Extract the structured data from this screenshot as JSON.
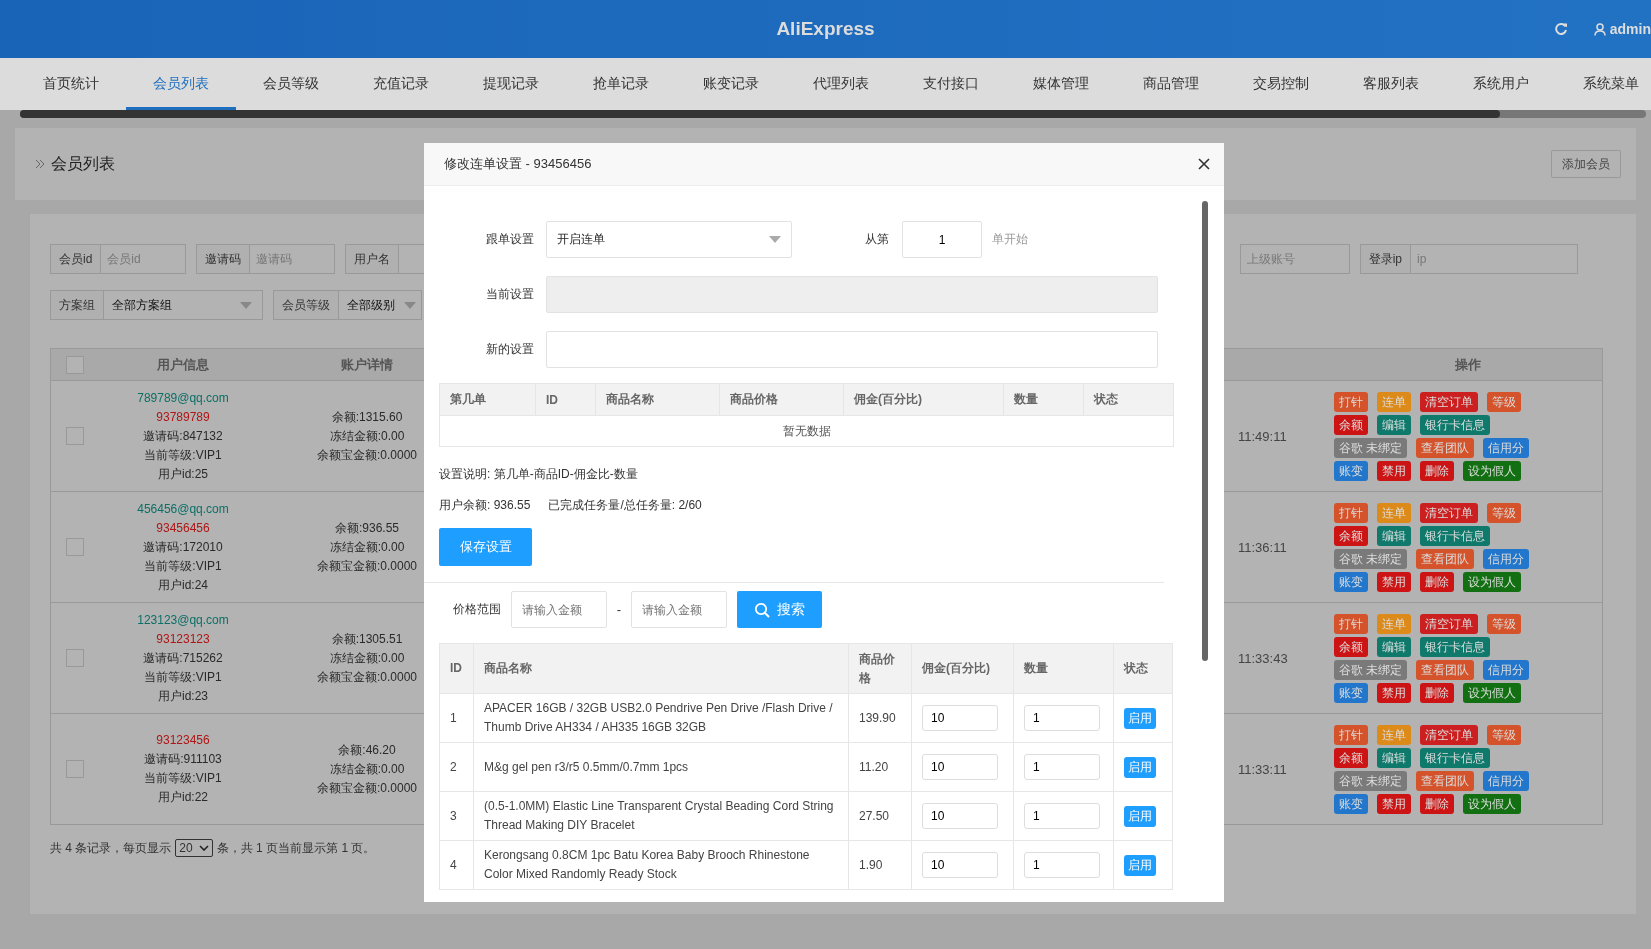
{
  "header": {
    "title": "AliExpress",
    "user": "admin"
  },
  "nav": [
    {
      "label": "首页统计",
      "selected": false
    },
    {
      "label": "会员列表",
      "selected": true
    },
    {
      "label": "会员等级",
      "selected": false
    },
    {
      "label": "充值记录",
      "selected": false
    },
    {
      "label": "提现记录",
      "selected": false
    },
    {
      "label": "抢单记录",
      "selected": false
    },
    {
      "label": "账变记录",
      "selected": false
    },
    {
      "label": "代理列表",
      "selected": false
    },
    {
      "label": "支付接口",
      "selected": false
    },
    {
      "label": "媒体管理",
      "selected": false
    },
    {
      "label": "商品管理",
      "selected": false
    },
    {
      "label": "交易控制",
      "selected": false
    },
    {
      "label": "客服列表",
      "selected": false
    },
    {
      "label": "系统用户",
      "selected": false
    },
    {
      "label": "系统菜单",
      "selected": false
    }
  ],
  "page": {
    "breadcrumb": "会员列表",
    "add_button": "添加会员"
  },
  "filters": {
    "row_1": [
      {
        "kind": "input",
        "label": "会员id",
        "placeholder": "会员id"
      },
      {
        "kind": "input",
        "label": "邀请码",
        "placeholder": "邀请码"
      },
      {
        "kind": "input",
        "label": "用户名"
      }
    ],
    "row_1_right": [
      {
        "kind": "input",
        "placeholder": "上级账号"
      },
      {
        "kind": "input",
        "label": "登录ip",
        "placeholder": "ip"
      }
    ],
    "row_2": [
      {
        "kind": "select",
        "label": "方案组",
        "value": "全部方案组"
      },
      {
        "kind": "select",
        "label": "会员等级",
        "value": "全部级别"
      }
    ]
  },
  "members": {
    "select_all_checked": false,
    "columns": [
      "用户信息",
      "账户详情",
      "操作"
    ],
    "rows": [
      {
        "checked": false,
        "email": "789789@qq.com",
        "phone": "93789789",
        "invite": "邀请码:847132",
        "level": "当前等级:VIP1",
        "user_id": "用户id:25",
        "balance": "余额:1315.60",
        "frozen": "冻结金额:0.00",
        "yeb": "余额宝金额:0.0000",
        "time": "11:49:11",
        "actions": [
          [
            {
              "label": "打针",
              "color": "#d4532b"
            },
            {
              "label": "连单",
              "color": "#dc8a1a"
            },
            {
              "label": "清空订单",
              "color": "#cc2020"
            },
            {
              "label": "等级",
              "color": "#d4532b"
            }
          ],
          [
            {
              "label": "余额",
              "color": "#cc1414"
            },
            {
              "label": "编辑",
              "color": "#0f7a6c"
            },
            {
              "label": "银行卡信息",
              "color": "#0f7a6c"
            }
          ],
          [
            {
              "label": "谷歌 未绑定",
              "color": "#7a7a7a"
            },
            {
              "label": "查看团队",
              "color": "#d4532b"
            },
            {
              "label": "信用分",
              "color": "#2277cc"
            }
          ],
          [
            {
              "label": "账变",
              "color": "#2277cc"
            },
            {
              "label": "禁用",
              "color": "#cc1414"
            },
            {
              "label": "删除",
              "color": "#cc1414"
            },
            {
              "label": "设为假人",
              "color": "#127012"
            }
          ]
        ]
      },
      {
        "checked": false,
        "email": "456456@qq.com",
        "phone": "93456456",
        "invite": "邀请码:172010",
        "level": "当前等级:VIP1",
        "user_id": "用户id:24",
        "balance": "余额:936.55",
        "frozen": "冻结金额:0.00",
        "yeb": "余额宝金额:0.0000",
        "time": "11:36:11",
        "actions": [
          [
            {
              "label": "打针",
              "color": "#d4532b"
            },
            {
              "label": "连单",
              "color": "#dc8a1a"
            },
            {
              "label": "清空订单",
              "color": "#cc2020"
            },
            {
              "label": "等级",
              "color": "#d4532b"
            }
          ],
          [
            {
              "label": "余额",
              "color": "#cc1414"
            },
            {
              "label": "编辑",
              "color": "#0f7a6c"
            },
            {
              "label": "银行卡信息",
              "color": "#0f7a6c"
            }
          ],
          [
            {
              "label": "谷歌 未绑定",
              "color": "#7a7a7a"
            },
            {
              "label": "查看团队",
              "color": "#d4532b"
            },
            {
              "label": "信用分",
              "color": "#2277cc"
            }
          ],
          [
            {
              "label": "账变",
              "color": "#2277cc"
            },
            {
              "label": "禁用",
              "color": "#cc1414"
            },
            {
              "label": "删除",
              "color": "#cc1414"
            },
            {
              "label": "设为假人",
              "color": "#127012"
            }
          ]
        ]
      },
      {
        "checked": false,
        "email": "123123@qq.com",
        "phone": "93123123",
        "invite": "邀请码:715262",
        "level": "当前等级:VIP1",
        "user_id": "用户id:23",
        "balance": "余额:1305.51",
        "frozen": "冻结金额:0.00",
        "yeb": "余额宝金额:0.0000",
        "time": "11:33:43",
        "actions": [
          [
            {
              "label": "打针",
              "color": "#d4532b"
            },
            {
              "label": "连单",
              "color": "#dc8a1a"
            },
            {
              "label": "清空订单",
              "color": "#cc2020"
            },
            {
              "label": "等级",
              "color": "#d4532b"
            }
          ],
          [
            {
              "label": "余额",
              "color": "#cc1414"
            },
            {
              "label": "编辑",
              "color": "#0f7a6c"
            },
            {
              "label": "银行卡信息",
              "color": "#0f7a6c"
            }
          ],
          [
            {
              "label": "谷歌 未绑定",
              "color": "#7a7a7a"
            },
            {
              "label": "查看团队",
              "color": "#d4532b"
            },
            {
              "label": "信用分",
              "color": "#2277cc"
            }
          ],
          [
            {
              "label": "账变",
              "color": "#2277cc"
            },
            {
              "label": "禁用",
              "color": "#cc1414"
            },
            {
              "label": "删除",
              "color": "#cc1414"
            },
            {
              "label": "设为假人",
              "color": "#127012"
            }
          ]
        ]
      },
      {
        "checked": false,
        "phone": "93123456",
        "invite": "邀请码:911103",
        "level": "当前等级:VIP1",
        "user_id": "用户id:22",
        "balance": "余额:46.20",
        "frozen": "冻结金额:0.00",
        "yeb": "余额宝金额:0.0000",
        "time": "11:33:11",
        "actions": [
          [
            {
              "label": "打针",
              "color": "#d4532b"
            },
            {
              "label": "连单",
              "color": "#dc8a1a"
            },
            {
              "label": "清空订单",
              "color": "#cc2020"
            },
            {
              "label": "等级",
              "color": "#d4532b"
            }
          ],
          [
            {
              "label": "余额",
              "color": "#cc1414"
            },
            {
              "label": "编辑",
              "color": "#0f7a6c"
            },
            {
              "label": "银行卡信息",
              "color": "#0f7a6c"
            }
          ],
          [
            {
              "label": "谷歌 未绑定",
              "color": "#7a7a7a"
            },
            {
              "label": "查看团队",
              "color": "#d4532b"
            },
            {
              "label": "信用分",
              "color": "#2277cc"
            }
          ],
          [
            {
              "label": "账变",
              "color": "#2277cc"
            },
            {
              "label": "禁用",
              "color": "#cc1414"
            },
            {
              "label": "删除",
              "color": "#cc1414"
            },
            {
              "label": "设为假人",
              "color": "#127012"
            }
          ]
        ]
      }
    ]
  },
  "pagination": {
    "prefix": "共 4 条记录，每页显示",
    "page_size": "20",
    "suffix": "条，共 1 页当前显示第 1 页。"
  },
  "modal": {
    "title": "修改连单设置 - 93456456",
    "follow": {
      "label": "跟单设置",
      "value": "开启连单"
    },
    "start": {
      "label": "从第",
      "value": "1",
      "suffix": "单开始"
    },
    "current": {
      "label": "当前设置",
      "disabled": true
    },
    "new_setting": {
      "label": "新的设置"
    },
    "setting_table": {
      "columns": [
        "第几单",
        "ID",
        "商品名称",
        "商品价格",
        "佣金(百分比)",
        "数量",
        "状态"
      ],
      "empty": "暂无数据"
    },
    "note": "设置说明: 第几单-商品ID-佣金比-数量",
    "balance": "用户余额: 936.55",
    "progress": "已完成任务量/总任务量: 2/60",
    "save_button": "保存设置",
    "price_filter": {
      "label": "价格范围",
      "min_placeholder": "请输入金额",
      "separator": "-",
      "max_placeholder": "请输入金额",
      "search_button": "搜索"
    },
    "products": {
      "columns": [
        "ID",
        "商品名称",
        "商品价格",
        "佣金(百分比)",
        "数量",
        "状态"
      ],
      "rows": [
        {
          "id": "1",
          "name": "APACER 16GB / 32GB USB2.0 Pendrive Pen Drive /Flash Drive / Thumb Drive AH334 / AH335 16GB 32GB",
          "price": "139.90",
          "commission": "10",
          "quantity": "1",
          "status": "启用"
        },
        {
          "id": "2",
          "name": "M&g gel pen r3/r5 0.5mm/0.7mm 1pcs",
          "price": "11.20",
          "commission": "10",
          "quantity": "1",
          "status": "启用"
        },
        {
          "id": "3",
          "name": "(0.5-1.0MM) Elastic Line Transparent Crystal Beading Cord String Thread Making DIY Bracelet",
          "price": "27.50",
          "commission": "10",
          "quantity": "1",
          "status": "启用"
        },
        {
          "id": "4",
          "name": "Kerongsang 0.8CM 1pc Batu Korea Baby Brooch Rhinestone Color Mixed Randomly Ready Stock",
          "price": "1.90",
          "commission": "10",
          "quantity": "1",
          "status": "启用"
        }
      ]
    }
  }
}
